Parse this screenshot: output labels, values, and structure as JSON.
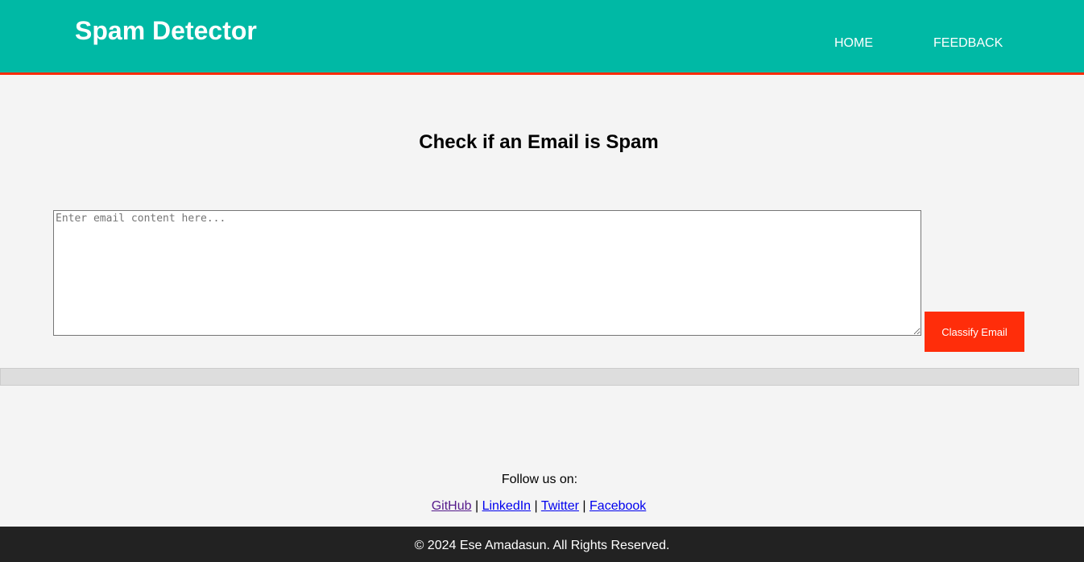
{
  "header": {
    "title": "Spam Detector",
    "nav": [
      "HOME",
      "FEEDBACK"
    ]
  },
  "main": {
    "heading": "Check if an Email is Spam",
    "email_input": {
      "placeholder": "Enter email content here...",
      "value": ""
    },
    "classify_button": "Classify Email",
    "result": ""
  },
  "social": {
    "follow_text": "Follow us on:",
    "links": [
      "GitHub",
      "LinkedIn",
      "Twitter",
      "Facebook"
    ],
    "separator": "|"
  },
  "footer": {
    "copyright": "© 2024 Ese Amadasun. All Rights Reserved."
  },
  "colors": {
    "header_bg": "#00b9a5",
    "accent": "#ff2d0a",
    "footer_bg": "#222222"
  }
}
